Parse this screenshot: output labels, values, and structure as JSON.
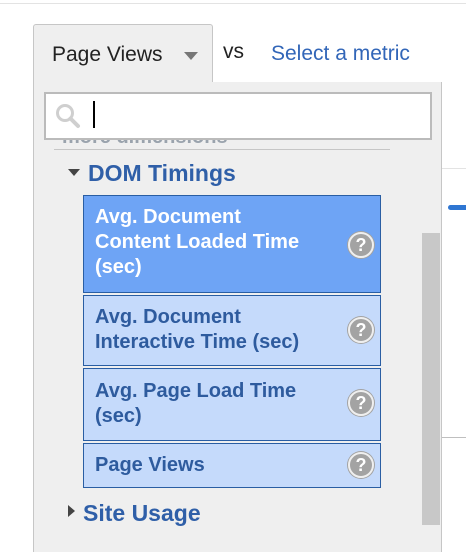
{
  "header": {
    "metric_selected": "Page Views",
    "vs_label": "vs",
    "select_metric_link": "Select a metric"
  },
  "search": {
    "value": "",
    "placeholder": ""
  },
  "dropdown": {
    "partial_heading": "more dimensions",
    "group": {
      "title": "DOM Timings",
      "expanded": true,
      "items": [
        {
          "lines": [
            "Avg. Document",
            "Content Loaded Time",
            "(sec)"
          ],
          "selected": true,
          "help": "?"
        },
        {
          "lines": [
            "Avg. Document",
            "Interactive Time (sec)"
          ],
          "selected": false,
          "help": "?"
        },
        {
          "lines": [
            "Avg. Page Load Time",
            "(sec)"
          ],
          "selected": false,
          "help": "?"
        },
        {
          "lines": [
            "Page Views"
          ],
          "selected": false,
          "help": "?"
        }
      ]
    },
    "next_group": {
      "title": "Site Usage",
      "expanded": false
    }
  },
  "colors": {
    "link": "#3266b8",
    "item_selected_bg": "#6ea4f5",
    "item_bg": "#c5dafb",
    "item_border": "#2a5ea3"
  }
}
